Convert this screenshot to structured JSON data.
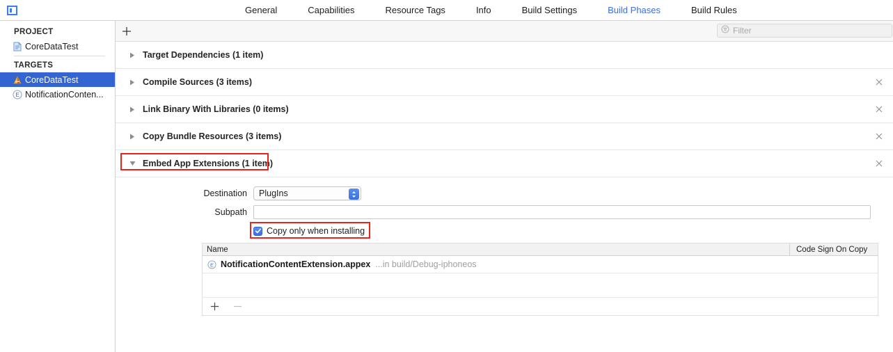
{
  "window": {
    "pane_toggle_icon": "sidebar-toggle-icon"
  },
  "tabs": [
    {
      "label": "General",
      "active": false
    },
    {
      "label": "Capabilities",
      "active": false
    },
    {
      "label": "Resource Tags",
      "active": false
    },
    {
      "label": "Info",
      "active": false
    },
    {
      "label": "Build Settings",
      "active": false
    },
    {
      "label": "Build Phases",
      "active": true
    },
    {
      "label": "Build Rules",
      "active": false
    }
  ],
  "sidebar": {
    "project_header": "PROJECT",
    "project_items": [
      {
        "label": "CoreDataTest",
        "icon": "project-document-icon"
      }
    ],
    "targets_header": "TARGETS",
    "target_items": [
      {
        "label": "CoreDataTest",
        "icon": "app-target-icon",
        "selected": true
      },
      {
        "label": "NotificationConten...",
        "icon": "extension-target-icon",
        "selected": false
      }
    ]
  },
  "toolbar": {
    "add_phase_label": "+",
    "add_phase_icon": "plus-icon",
    "filter_icon": "filter-icon",
    "filter_placeholder": "Filter",
    "filter_value": ""
  },
  "phases": [
    {
      "title": "Target Dependencies (1 item)",
      "expanded": false,
      "removable": false,
      "annotated": false
    },
    {
      "title": "Compile Sources (3 items)",
      "expanded": false,
      "removable": true,
      "annotated": false
    },
    {
      "title": "Link Binary With Libraries (0 items)",
      "expanded": false,
      "removable": true,
      "annotated": false
    },
    {
      "title": "Copy Bundle Resources (3 items)",
      "expanded": false,
      "removable": true,
      "annotated": false
    },
    {
      "title": "Embed App Extensions (1 item)",
      "expanded": true,
      "removable": true,
      "annotated": true
    }
  ],
  "embed_phase": {
    "destination_label": "Destination",
    "destination_value": "PlugIns",
    "subpath_label": "Subpath",
    "subpath_value": "",
    "copy_only_label": "Copy only when installing",
    "copy_only_checked": true,
    "table": {
      "columns": [
        "Name",
        "Code Sign On Copy"
      ],
      "rows": [
        {
          "icon": "extension-file-icon",
          "name": "NotificationContentExtension.appex",
          "path": "...in build/Debug-iphoneos",
          "code_sign_on_copy": ""
        }
      ]
    },
    "footer": {
      "add_icon": "plus-icon",
      "remove_icon": "minus-icon"
    }
  },
  "annotation": {
    "color": "#e8241c"
  }
}
